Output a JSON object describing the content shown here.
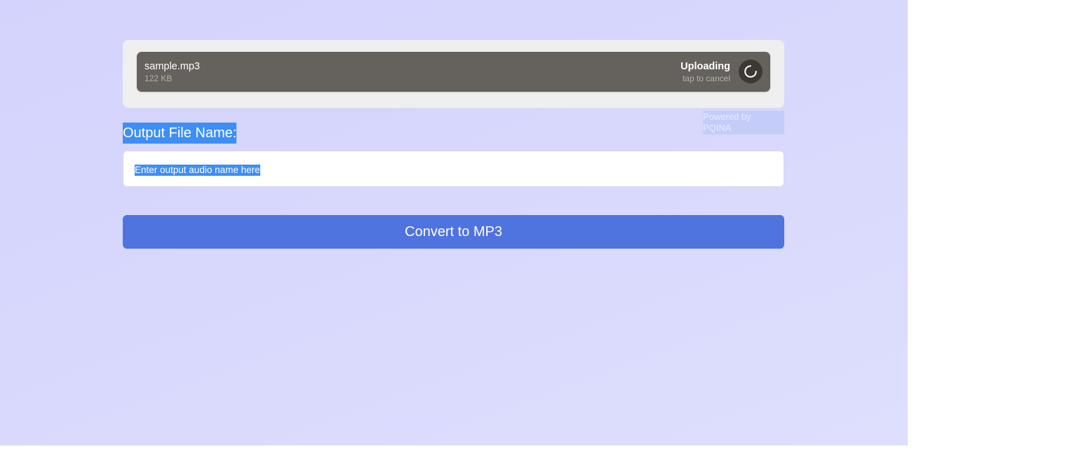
{
  "uploader": {
    "file": {
      "name": "sample.mp3",
      "size": "122 KB",
      "status": "Uploading",
      "action_hint": "tap to cancel",
      "icon": "loading-spinner-icon"
    },
    "credit": "Powered by PQINA"
  },
  "form": {
    "output_label": "Output File Name:",
    "output_placeholder": "Enter output audio name here",
    "output_value": ""
  },
  "actions": {
    "convert_label": "Convert to MP3"
  },
  "colors": {
    "background": "#d6d6fd",
    "file_item": "#65615c",
    "panel": "#f0efef",
    "button": "#4f73df",
    "selection": "#3d8ef5"
  }
}
